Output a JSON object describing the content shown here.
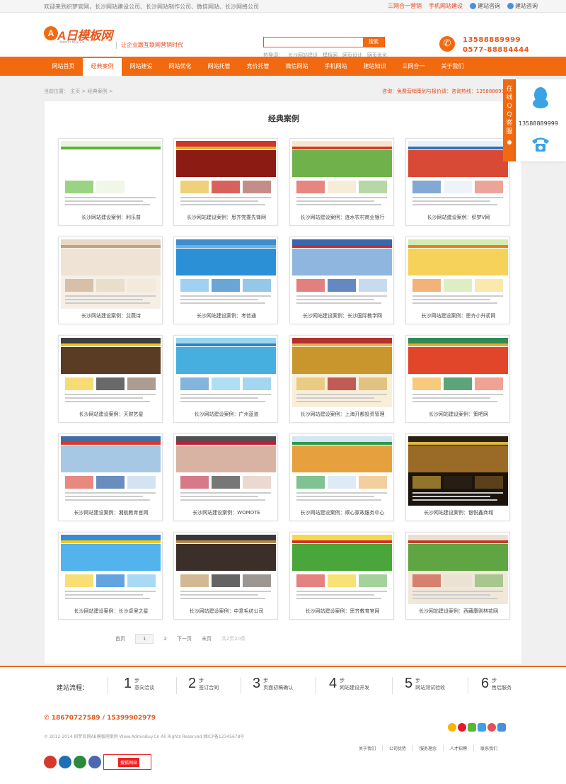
{
  "topbar": {
    "welcome": "欢迎来到织梦官网，长沙网站建设公司、长沙网站制作公司、微信网站、长沙网络公司",
    "links": [
      "三网合一营销",
      "手机网站建设",
      "建站咨询",
      "建站咨询"
    ]
  },
  "header": {
    "logo_mark": "A",
    "logo_text": "A日模板网",
    "logo_sub": "Admin Buy Co",
    "slogan": "让企业跟互联网营销时代",
    "search_placeholder": "",
    "search_button": "搜索",
    "hotwords_label": "热搜词：",
    "hotwords": [
      "长沙网站建设",
      "模板网",
      "网页设计",
      "网页优化"
    ],
    "phone1": "13588889999",
    "phone2": "0577-88884444"
  },
  "nav": [
    "网站首页",
    "经典案例",
    "网站建设",
    "网站优化",
    "网站托管",
    "竞价托管",
    "微信网站",
    "手机网站",
    "建站知识",
    "三网合一",
    "关于我们"
  ],
  "nav_active_index": 1,
  "breadcrumb": {
    "label": "当前位置：",
    "home": "主页",
    "sep": ">",
    "current": "经典案例",
    "tail": ">"
  },
  "notice": "咨询：免费营销策划与报价请：咨询热线：13588889999",
  "main": {
    "title": "经典案例",
    "cases": [
      {
        "caption": "长沙网站建设案例：利乐普",
        "theme": "green"
      },
      {
        "caption": "长沙网站建设案例：思齐党委先锋网",
        "theme": "red"
      },
      {
        "caption": "长沙网站建设案例：连水农村商业银行",
        "theme": "bank"
      },
      {
        "caption": "长沙网站建设案例：织梦V网",
        "theme": "blue"
      },
      {
        "caption": "长沙网站建设案例：艾薇诗",
        "theme": "beige"
      },
      {
        "caption": "长沙网站建设案例：考信通",
        "theme": "blue2"
      },
      {
        "caption": "长沙网站建设案例：长沙国际教学网",
        "theme": "usa"
      },
      {
        "caption": "长沙网站建设案例：思齐小升初网",
        "theme": "kids"
      },
      {
        "caption": "长沙网站建设案例：天财艺星",
        "theme": "stage"
      },
      {
        "caption": "长沙网站建设案例：广州蓝道",
        "theme": "water"
      },
      {
        "caption": "长沙网站建设案例：上海开都投资管理",
        "theme": "gold"
      },
      {
        "caption": "长沙网站建设案例：策吧网",
        "theme": "green2"
      },
      {
        "caption": "长沙网站建设案例：湘航教育官网",
        "theme": "city"
      },
      {
        "caption": "长沙网站建设案例：WOMOTE",
        "theme": "fashion"
      },
      {
        "caption": "长沙网站建设案例：顺心家政服务中心",
        "theme": "family"
      },
      {
        "caption": "长沙网站建设案例：银悦鑫商城",
        "theme": "food"
      },
      {
        "caption": "长沙网站建设案例：长沙卓里之星",
        "theme": "edu"
      },
      {
        "caption": "长沙网站建设案例：中意毛纺公司",
        "theme": "dark"
      },
      {
        "caption": "长沙网站建设案例：思齐教育官网",
        "theme": "yellow"
      },
      {
        "caption": "长沙网站建设案例：西藏康则林花网",
        "theme": "plate"
      }
    ],
    "pager": {
      "first": "首页",
      "current": "1",
      "page2": "2",
      "next": "下一页",
      "last": "末页",
      "count": "共2页20条"
    }
  },
  "process": {
    "label": "建站流程：",
    "step_word": "步",
    "steps": [
      {
        "num": "1",
        "text": "意向洽谈"
      },
      {
        "num": "2",
        "text": "签订合同"
      },
      {
        "num": "3",
        "text": "页面初稿确认"
      },
      {
        "num": "4",
        "text": "网站建设开发"
      },
      {
        "num": "5",
        "text": "网站测试验收"
      },
      {
        "num": "6",
        "text": "售后服务"
      }
    ]
  },
  "footer": {
    "phones": "18670727589 / 15399902979",
    "copyright": "© 2012-2014 织梦官网AB模板网案例 Www.AdminBuy.Cn All Rights Reserved 湘ICP备12345678号",
    "links": [
      "关于我们",
      "公司优势",
      "服务理念",
      "人才招聘",
      "联系我们"
    ],
    "badge_text": "搜狐网站"
  },
  "float": {
    "tab": "在线QQ客服",
    "number": "13588889999"
  },
  "colors": {
    "accent": "#f26a10",
    "accent_text": "#e8561c"
  }
}
